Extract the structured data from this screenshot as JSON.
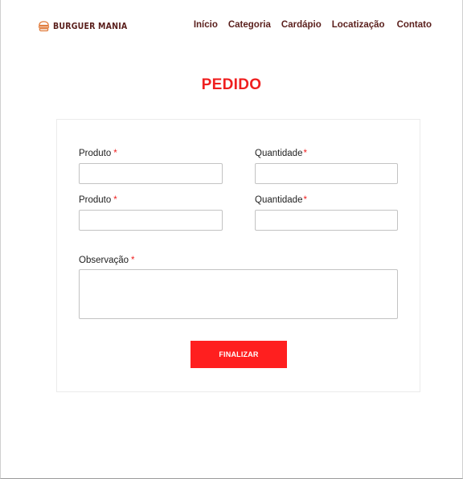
{
  "brand": {
    "name": "BURGUER MANIA",
    "icon": "burger-icon"
  },
  "nav": {
    "items": [
      "Início",
      "Categoria",
      "Cardápio",
      "Locatização",
      "Contato"
    ]
  },
  "page": {
    "title": "PEDIDO"
  },
  "form": {
    "required_mark": "*",
    "row1": {
      "product_label": "Produto",
      "product_value": "",
      "quantity_label": "Quantidade",
      "quantity_value": ""
    },
    "row2": {
      "product_label": "Produto",
      "product_value": "",
      "quantity_label": "Quantidade",
      "quantity_value": ""
    },
    "observation": {
      "label": "Observação",
      "value": ""
    },
    "submit_label": "FINALIZAR"
  },
  "colors": {
    "accent": "#ef1f1f",
    "button": "#ff1f1f",
    "brand_text": "#5a1f1c",
    "border": "#c3c3c3"
  }
}
